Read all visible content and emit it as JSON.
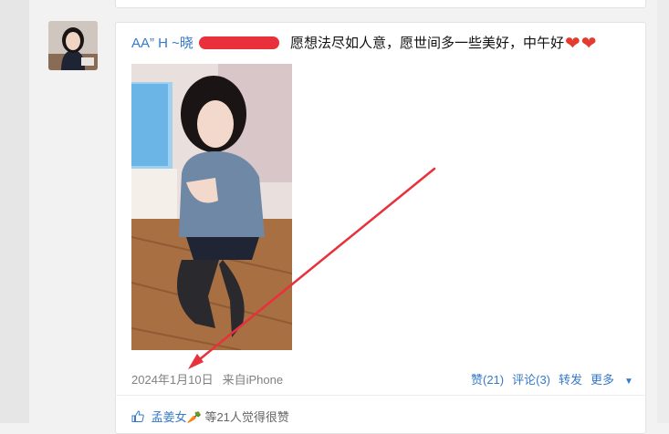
{
  "post": {
    "author": "AA” H ~晓",
    "text": "愿想法尽如人意，愿世间多一些美好，中午好",
    "emoji": [
      "❤",
      "❤"
    ],
    "date": "2024年1月10日",
    "source": "来自iPhone"
  },
  "actions": {
    "like": "赞(21)",
    "comment": "评论(3)",
    "repost": "转发",
    "more": "更多"
  },
  "likes_bar": {
    "liker": "孟姜女",
    "liker_emoji": "🥕",
    "summary": "等21人觉得很赞"
  },
  "colors": {
    "link": "#3579c8",
    "annotation": "#e8313a",
    "heart": "#e43b2f"
  },
  "icons": [
    "heart-icon",
    "chevron-down-icon",
    "thumbs-up-icon",
    "annotation-arrow"
  ]
}
